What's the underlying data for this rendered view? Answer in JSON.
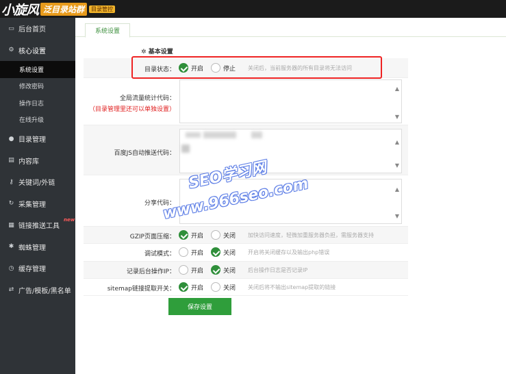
{
  "header": {
    "logo_main": "小旋风",
    "logo_sub": "泛目录站群",
    "logo_tag": "目录管控"
  },
  "sidebar": {
    "items": [
      {
        "icon": "monitor-icon",
        "label": "后台首页"
      },
      {
        "icon": "gear-icon",
        "label": "核心设置"
      },
      {
        "icon": "user-icon",
        "label": "目录管理"
      },
      {
        "icon": "document-icon",
        "label": "内容库"
      },
      {
        "icon": "key-icon",
        "label": "关键词/外链"
      },
      {
        "icon": "sync-icon",
        "label": "采集管理"
      },
      {
        "icon": "grid-icon",
        "label": "链接推送工具",
        "badge": "new"
      },
      {
        "icon": "spider-icon",
        "label": "蜘蛛管理"
      },
      {
        "icon": "clock-icon",
        "label": "缓存管理"
      },
      {
        "icon": "shuffle-icon",
        "label": "广告/模板/黑名单"
      }
    ],
    "sub_items": [
      "系统设置",
      "修改密码",
      "操作日志",
      "在线升级"
    ]
  },
  "tab": {
    "label": "系统设置"
  },
  "section": {
    "title": "基本设置"
  },
  "settings": {
    "dir_status": {
      "label": "目录状态：",
      "on": "开启",
      "off": "停止",
      "hint": "关闭后，当前服务器的所有目录将无法访问",
      "value": "on"
    },
    "traffic_code": {
      "label": "全局流量统计代码：",
      "note": "（目录管理里还可以单独设置）"
    },
    "baidu_push": {
      "label": "百度JS自动推送代码："
    },
    "share_code": {
      "label": "分享代码："
    },
    "gzip": {
      "label": "GZIP页面压缩：",
      "on": "开启",
      "off": "关闭",
      "hint": "加快访问速度，轻微加重服务器负担，需服务器支持",
      "value": "on"
    },
    "debug": {
      "label": "调试模式：",
      "on": "开启",
      "off": "关闭",
      "hint": "开启将关闭缓存以及输出php错误",
      "value": "off"
    },
    "log_ip": {
      "label": "记录后台操作IP：",
      "on": "开启",
      "off": "关闭",
      "hint": "后台操作日志是否记录IP",
      "value": "off"
    },
    "sitemap": {
      "label": "sitemap链接提取开关：",
      "on": "开启",
      "off": "关闭",
      "hint": "关闭后将不输出sitemap提取的链接",
      "value": "on"
    }
  },
  "save_button": "保存设置",
  "watermark": {
    "line1": "SEO学习网",
    "line2": "www.966seo.com"
  }
}
